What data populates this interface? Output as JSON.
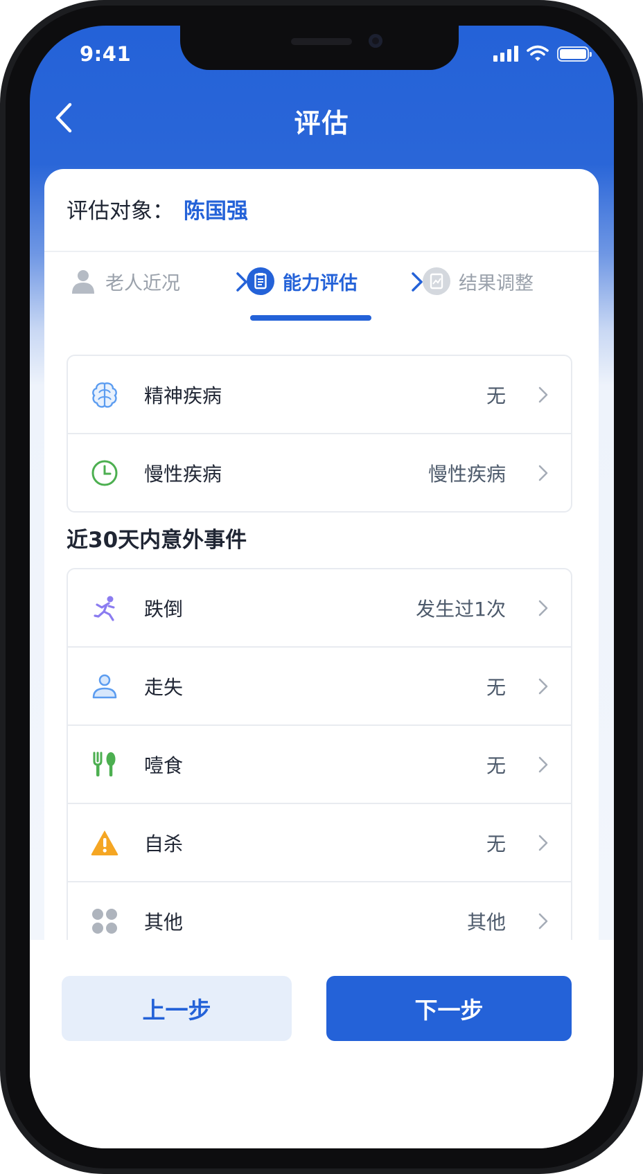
{
  "status_bar": {
    "time": "9:41"
  },
  "nav": {
    "title": "评估"
  },
  "subject": {
    "label": "评估对象：",
    "name": "陈国强"
  },
  "steps": [
    {
      "label": "老人近况",
      "icon": "person-icon",
      "state": "inactive"
    },
    {
      "label": "能力评估",
      "icon": "clipboard-icon",
      "state": "active"
    },
    {
      "label": "结果调整",
      "icon": "chart-report-icon",
      "state": "inactive"
    }
  ],
  "diseases": [
    {
      "icon": "brain-icon",
      "label": "精神疾病",
      "value": "无"
    },
    {
      "icon": "clock-icon",
      "label": "慢性疾病",
      "value": "慢性疾病"
    }
  ],
  "events_section": {
    "title": "近30天内意外事件"
  },
  "events": [
    {
      "icon": "fall-person-icon",
      "label": "跌倒",
      "value": "发生过1次"
    },
    {
      "icon": "lost-person-icon",
      "label": "走失",
      "value": "无"
    },
    {
      "icon": "utensils-icon",
      "label": "噎食",
      "value": "无"
    },
    {
      "icon": "warning-icon",
      "label": "自杀",
      "value": "无"
    },
    {
      "icon": "grid-other-icon",
      "label": "其他",
      "value": "其他"
    }
  ],
  "buttons": {
    "prev": "上一步",
    "next": "下一步"
  },
  "colors": {
    "primary": "#2462d8",
    "inactive": "#9aa1ab",
    "chronic_icon": "#4caf50",
    "warning_icon": "#f5a623",
    "brain_icon": "#5b9cf0",
    "fall_icon": "#8b7cf0"
  }
}
